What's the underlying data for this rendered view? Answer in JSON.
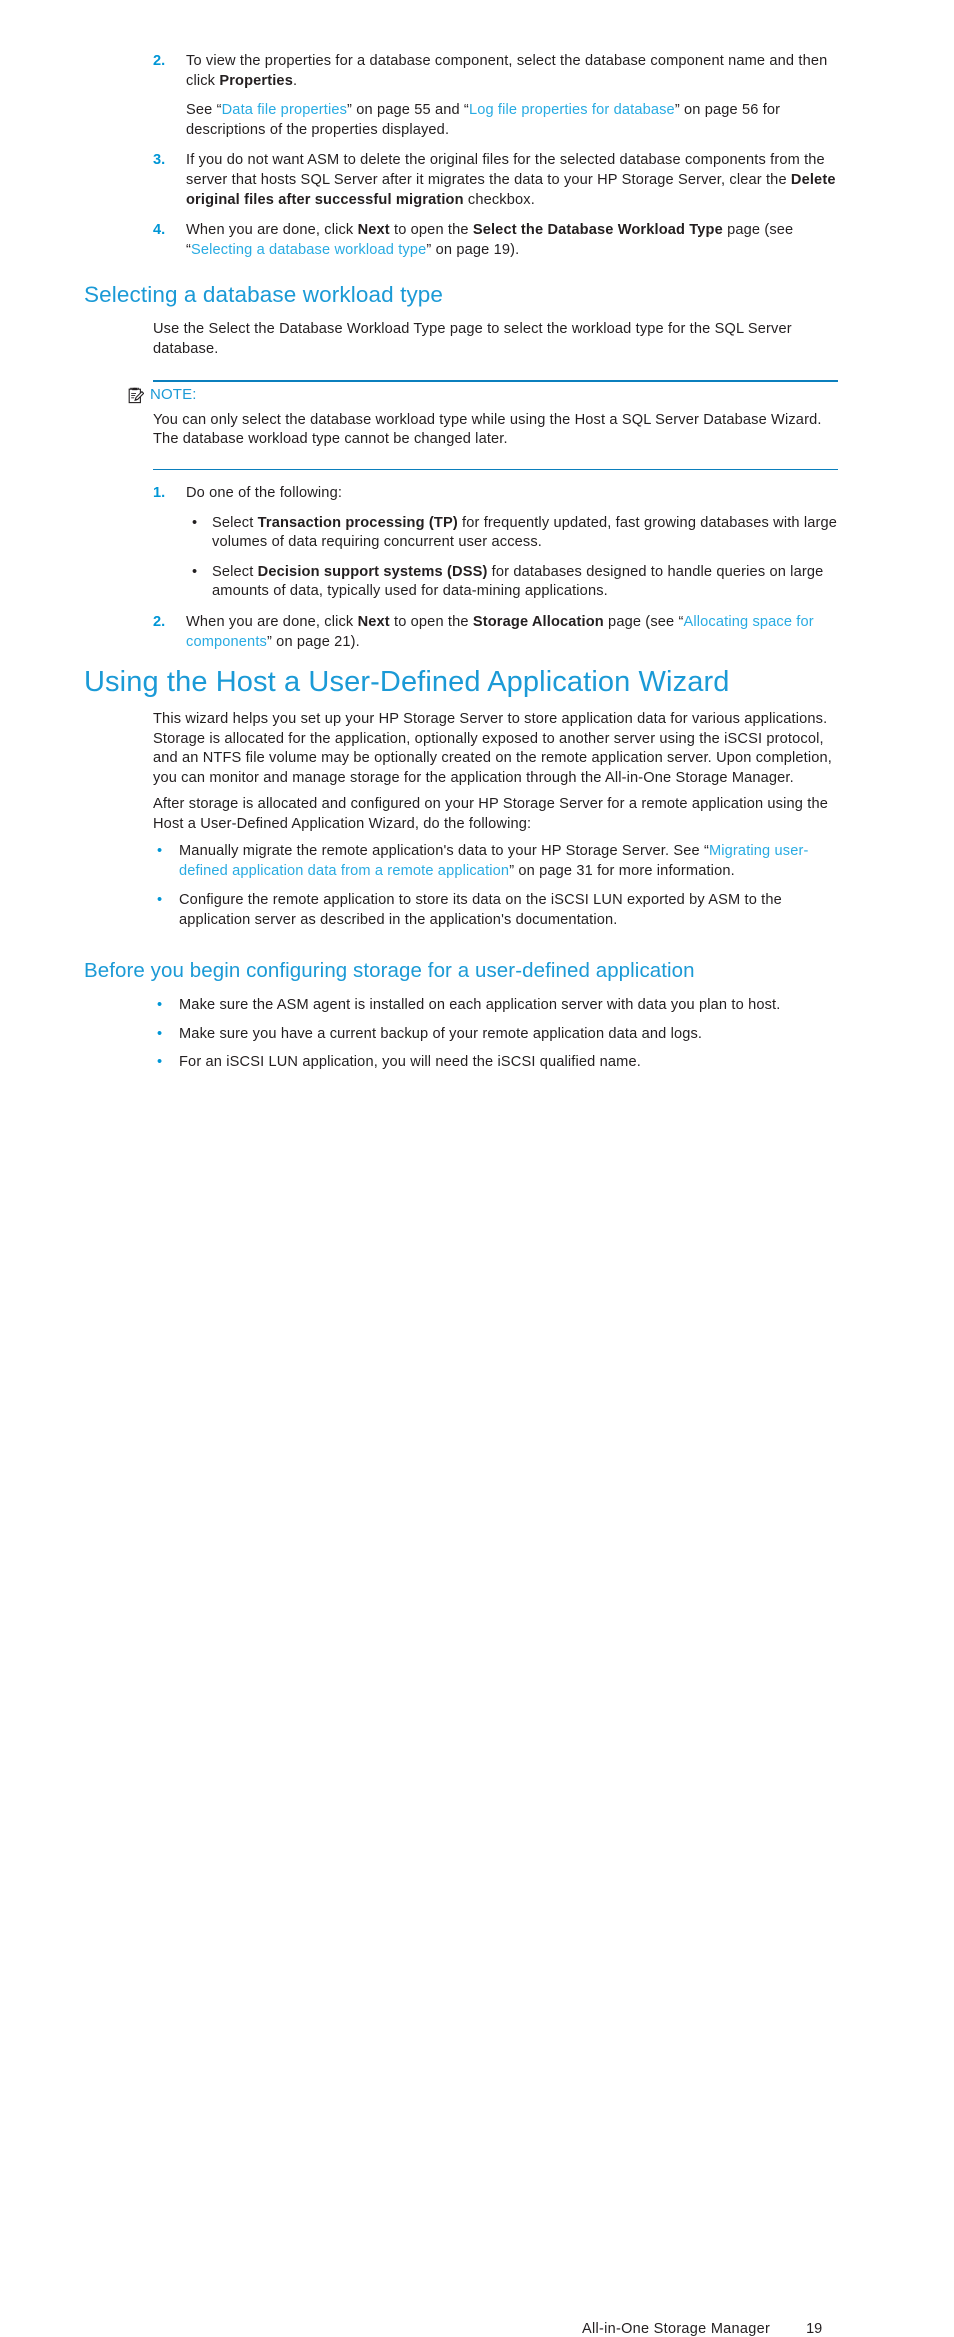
{
  "page": {
    "footer_title": "All-in-One Storage Manager",
    "footer_page_number": "19"
  },
  "colors": {
    "heading_blue": "#1b9ad6",
    "link_blue": "#29abe2",
    "marker_blue": "#0096d6",
    "rule_blue": "#0b7fbd",
    "body_black": "#231f20"
  },
  "top_steps": [
    {
      "number": "2.",
      "parts": [
        {
          "text": "To view the properties for a database component, select the database component name and then click ",
          "style": "normal"
        },
        {
          "text": "Properties",
          "style": "bold"
        },
        {
          "text": ".",
          "style": "normal"
        }
      ]
    },
    {
      "number": "3.",
      "parts": [
        {
          "text": "If you do not want ASM to delete the original files for the selected database components from the server that hosts SQL Server after it migrates the data to your HP Storage Server, clear the ",
          "style": "normal"
        },
        {
          "text": "Delete original files after successful migration",
          "style": "bold"
        },
        {
          "text": " checkbox.",
          "style": "normal"
        }
      ]
    },
    {
      "number": "4.",
      "parts": [
        {
          "text": "When you are done, click ",
          "style": "normal"
        },
        {
          "text": "Next",
          "style": "bold"
        },
        {
          "text": " to open the ",
          "style": "normal"
        },
        {
          "text": "Select the Database Workload Type",
          "style": "bold"
        },
        {
          "text": " page (see “",
          "style": "normal"
        },
        {
          "text": "Selecting a database workload type",
          "style": "link"
        },
        {
          "text": "” on page 19).",
          "style": "normal"
        }
      ]
    }
  ],
  "step2_followup": {
    "parts": [
      {
        "text": "See “",
        "style": "normal"
      },
      {
        "text": "Data file properties",
        "style": "link"
      },
      {
        "text": "” on page 55 and “",
        "style": "normal"
      },
      {
        "text": "Log file properties for database",
        "style": "link"
      },
      {
        "text": "” on page 56 for descriptions of the properties displayed.",
        "style": "normal"
      }
    ]
  },
  "section_workload": {
    "heading": "Selecting a database workload type",
    "intro": "Use the Select the Database Workload Type page to select the workload type for the SQL Server database.",
    "note": {
      "icon": "note-clipboard-icon",
      "label": "NOTE:",
      "text": "You can only select the database workload type while using the Host a SQL Server Database Wizard. The database workload type cannot be changed later."
    },
    "steps": [
      {
        "number": "1.",
        "parts": [
          {
            "text": "Do one of the following:",
            "style": "normal"
          }
        ],
        "sub_bullets": [
          {
            "marker": "•",
            "parts": [
              {
                "text": "Select ",
                "style": "normal"
              },
              {
                "text": "Transaction processing (TP)",
                "style": "bold"
              },
              {
                "text": " for frequently updated, fast growing databases with large volumes of data requiring concurrent user access.",
                "style": "normal"
              }
            ]
          },
          {
            "marker": "•",
            "parts": [
              {
                "text": "Select ",
                "style": "normal"
              },
              {
                "text": "Decision support systems (DSS)",
                "style": "bold"
              },
              {
                "text": " for databases designed to handle queries on large amounts of data, typically used for data-mining applications.",
                "style": "normal"
              }
            ]
          }
        ]
      },
      {
        "number": "2.",
        "parts": [
          {
            "text": "When you are done, click ",
            "style": "normal"
          },
          {
            "text": "Next",
            "style": "bold"
          },
          {
            "text": " to open the ",
            "style": "normal"
          },
          {
            "text": "Storage Allocation",
            "style": "bold"
          },
          {
            "text": " page (see “",
            "style": "normal"
          },
          {
            "text": "Allocating space for components",
            "style": "link"
          },
          {
            "text": "” on page 21).",
            "style": "normal"
          }
        ],
        "sub_bullets": []
      }
    ]
  },
  "section_wizard": {
    "heading": "Using the Host a User-Defined Application Wizard",
    "paragraph1": "This wizard helps you set up your HP Storage Server to store application data for various applications. Storage is allocated for the application, optionally exposed to another server using the iSCSI protocol, and an NTFS file volume may be optionally created on the remote application server. Upon completion, you can monitor and manage storage for the application through the All-in-One Storage Manager.",
    "paragraph2": "After storage is allocated and configured on your HP Storage Server for a remote application using the Host a User-Defined Application Wizard, do the following:",
    "bullets": [
      {
        "marker": "•",
        "parts": [
          {
            "text": "Manually migrate the remote application's data to your HP Storage Server. See “",
            "style": "normal"
          },
          {
            "text": "Migrating user-defined application data from a remote application",
            "style": "link"
          },
          {
            "text": "” on page 31 for more information.",
            "style": "normal"
          }
        ]
      },
      {
        "marker": "•",
        "parts": [
          {
            "text": "Configure the remote application to store its data on the iSCSI LUN exported by ASM to the application server as described in the application's documentation.",
            "style": "normal"
          }
        ]
      }
    ]
  },
  "section_before_begin": {
    "heading": "Before you begin configuring storage for a user-defined application",
    "bullets": [
      {
        "marker": "•",
        "text": "Make sure the ASM agent is installed on each application server with data you plan to host."
      },
      {
        "marker": "•",
        "text": "Make sure you have a current backup of your remote application data and logs."
      },
      {
        "marker": "•",
        "text": "For an iSCSI LUN application, you will need the iSCSI qualified name."
      }
    ]
  }
}
